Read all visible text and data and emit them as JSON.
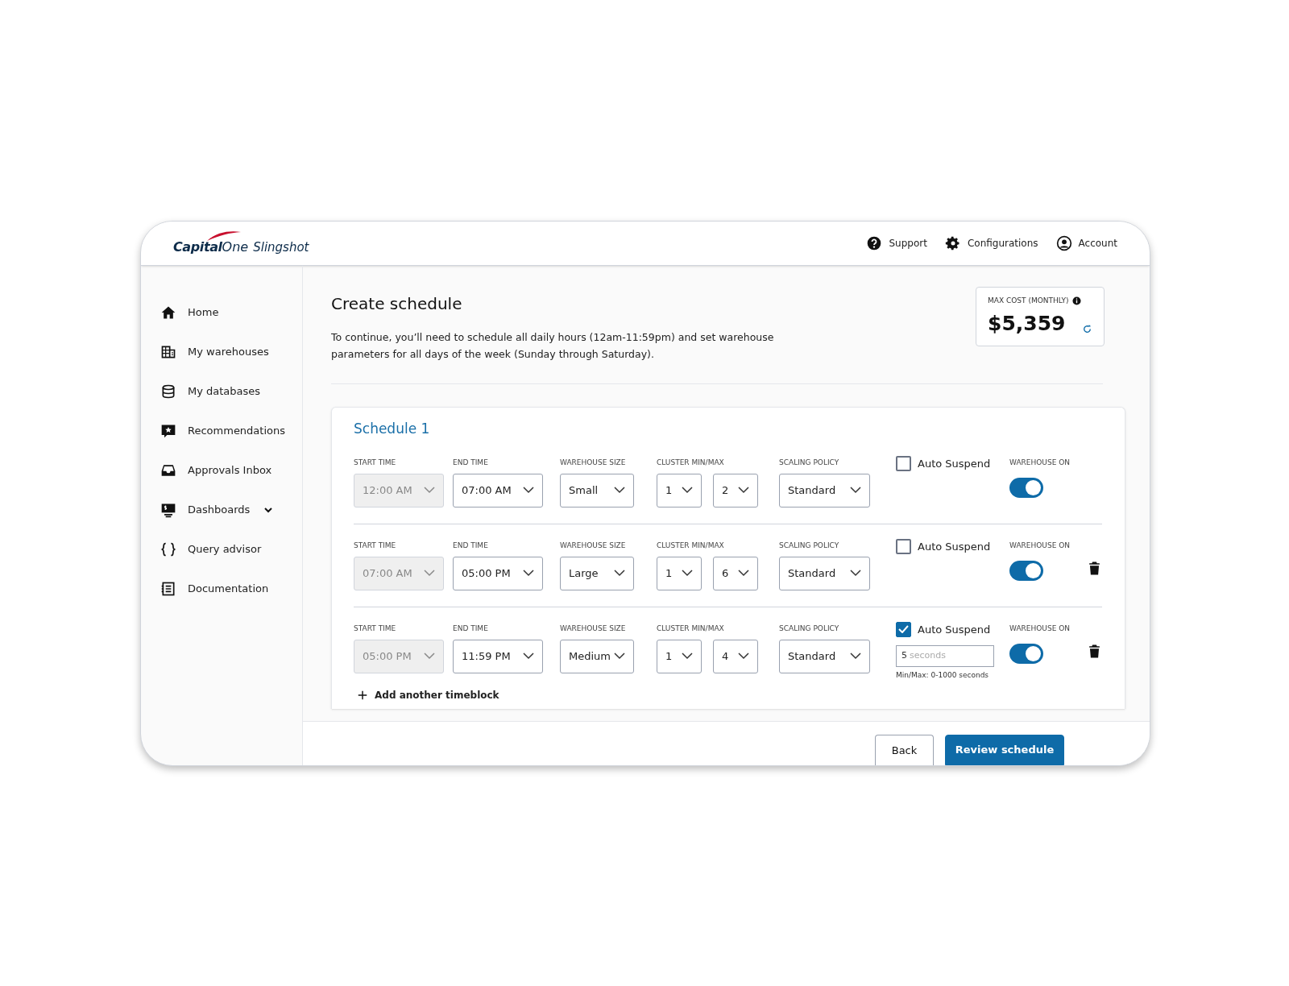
{
  "header": {
    "logo_word_1": "Capital",
    "logo_word_2": "One",
    "product": "Slingshot",
    "links": [
      {
        "label": "Support"
      },
      {
        "label": "Configurations"
      },
      {
        "label": "Account"
      }
    ]
  },
  "sidebar": {
    "items": [
      {
        "label": "Home",
        "has_caret": false
      },
      {
        "label": "My warehouses",
        "has_caret": false
      },
      {
        "label": "My databases",
        "has_caret": false
      },
      {
        "label": "Recommendations",
        "has_caret": false
      },
      {
        "label": "Approvals Inbox",
        "has_caret": false
      },
      {
        "label": "Dashboards",
        "has_caret": true
      },
      {
        "label": "Query advisor",
        "has_caret": false
      },
      {
        "label": "Documentation",
        "has_caret": false
      }
    ]
  },
  "page": {
    "title": "Create schedule",
    "description": "To continue, you’ll need to schedule all daily hours (12am-11:59pm) and set warehouse parameters for all days of the week (Sunday through Saturday).",
    "cost": {
      "label": "MAX COST (MONTHLY)",
      "value": "$5,359"
    }
  },
  "schedule": {
    "title": "Schedule 1",
    "rows": [
      {
        "labels": {
          "start": "START TIME",
          "end": "END TIME",
          "size": "WAREHOUSE SIZE",
          "cluster": "CLUSTER MIN/MAX",
          "policy": "SCALING POLICY",
          "auto": "Auto Suspend",
          "on": "WAREHOUSE ON"
        },
        "start": "12:00 AM",
        "start_disabled": true,
        "end": "07:00 AM",
        "size": "Small",
        "cluster_min": "1",
        "cluster_max": "2",
        "policy": "Standard",
        "auto_suspend": false,
        "warehouse_on": true,
        "deletable": false
      },
      {
        "labels": {
          "start": "START TIME",
          "end": "END TIME",
          "size": "WAREHOUSE SIZE",
          "cluster": "CLUSTER MIN/MAX",
          "policy": "SCALING POLICY",
          "auto": "Auto Suspend",
          "on": "WAREHOUSE ON"
        },
        "start": "07:00 AM",
        "start_disabled": true,
        "end": "05:00 PM",
        "size": "Large",
        "cluster_min": "1",
        "cluster_max": "6",
        "policy": "Standard",
        "auto_suspend": false,
        "warehouse_on": true,
        "deletable": true
      },
      {
        "labels": {
          "start": "START TIME",
          "end": "END TIME",
          "size": "WAREHOUSE SIZE",
          "cluster": "CLUSTER MIN/MAX",
          "policy": "SCALING POLICY",
          "auto": "Auto Suspend",
          "on": "WAREHOUSE ON"
        },
        "start": "05:00 PM",
        "start_disabled": true,
        "end": "11:59 PM",
        "size": "Medium",
        "cluster_min": "1",
        "cluster_max": "4",
        "policy": "Standard",
        "auto_suspend": true,
        "suspend": {
          "value": "5",
          "unit": "seconds",
          "hint": "Min/Max: 0-1000 seconds"
        },
        "warehouse_on": true,
        "deletable": true
      }
    ],
    "add_label": "Add another timeblock"
  },
  "footer": {
    "buttons": [
      {
        "label": "Back",
        "kind": "secondary"
      },
      {
        "label": "Review schedule",
        "kind": "primary"
      }
    ]
  }
}
